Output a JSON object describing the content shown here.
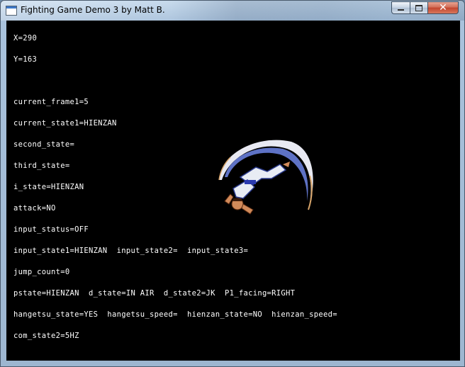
{
  "window": {
    "title": "Fighting Game Demo 3 by Matt B."
  },
  "debug": {
    "lines": [
      "X=290",
      "Y=163",
      "",
      "current_frame1=5",
      "current_state1=HIENZAN",
      "second_state=",
      "third_state=",
      "i_state=HIENZAN",
      "attack=NO",
      "input_status=OFF",
      "input_state1=HIENZAN  input_state2=  input_state3=",
      "jump_count=0",
      "pstate=HIENZAN  d_state=IN AIR  d_state2=JK  P1_facing=RIGHT",
      "hangetsu_state=YES  hangetsu_speed=  hienzan_state=NO  hienzan_speed=",
      "com_state2=5HZ"
    ]
  },
  "colors": {
    "background": "#000000",
    "text": "#ffffff",
    "close_button": "#c2452e"
  },
  "icons": {
    "app": "app-window-icon",
    "minimize": "minimize-icon",
    "maximize": "maximize-icon",
    "close": "close-icon"
  }
}
